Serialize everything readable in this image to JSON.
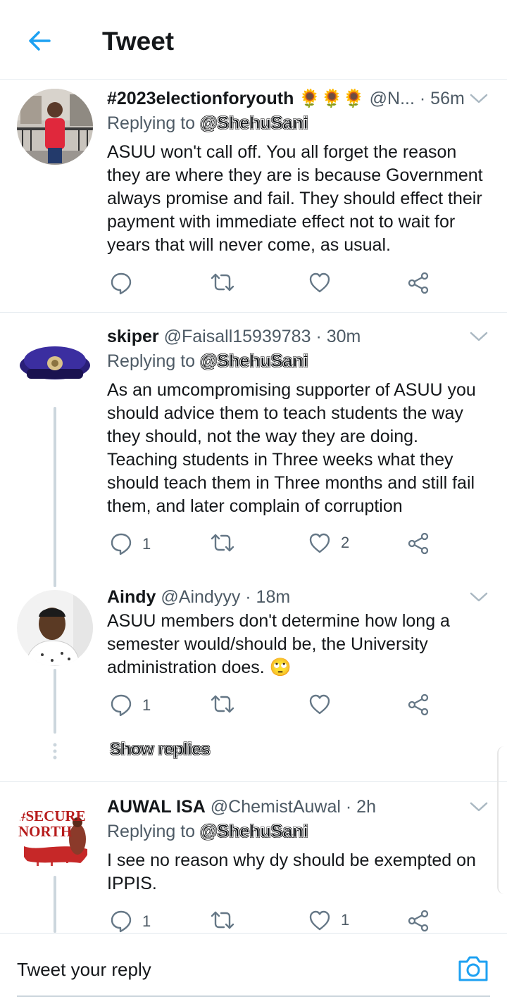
{
  "header": {
    "title": "Tweet"
  },
  "colors": {
    "accent": "#1da1f2",
    "text": "#14171a",
    "secondary": "#657786"
  },
  "tweets": [
    {
      "name": "#2023electionforyouth",
      "emoji": "🌻🌻🌻",
      "handle": "@N...",
      "time": "· 56m",
      "replying_prefix": "Replying to",
      "replying_to": "@ShehuSani",
      "text": "ASUU won't call off. You all forget the reason they are where they are is because Government always promise and fail. They should effect their payment with immediate effect not to wait for years that will never come, as usual.",
      "reply_count": "",
      "retweet_count": "",
      "like_count": ""
    },
    {
      "name": "skiper",
      "handle": "@Faisall15939783",
      "time": "· 30m",
      "replying_prefix": "Replying to",
      "replying_to": "@ShehuSani",
      "text": "As an umcompromising supporter of ASUU you should advice them to teach students the way they should, not the way they are doing. Teaching students in Three weeks what they should teach them in Three months and still fail them, and later complain of corruption",
      "reply_count": "1",
      "retweet_count": "",
      "like_count": "2"
    },
    {
      "name": "Aindy",
      "handle": "@Aindyyy",
      "time": "· 18m",
      "text": "ASUU members don't determine how long a semester would/should be, the University administration does. 🙄",
      "reply_count": "1",
      "retweet_count": "",
      "like_count": ""
    },
    {
      "name": "AUWAL ISA",
      "handle": "@ChemistAuwal",
      "time": "· 2h",
      "replying_prefix": "Replying to",
      "replying_to": "@ShehuSani",
      "text": "I see no reason why dy should be exempted on IPPIS.",
      "avatar_text": "#SECURE NORTH",
      "reply_count": "1",
      "retweet_count": "",
      "like_count": "1"
    }
  ],
  "show_replies": "Show replies",
  "composer": {
    "placeholder": "Tweet your reply"
  },
  "icons": [
    "back-arrow-icon",
    "chevron-down-icon",
    "reply-icon",
    "retweet-icon",
    "like-icon",
    "share-icon",
    "camera-icon"
  ]
}
